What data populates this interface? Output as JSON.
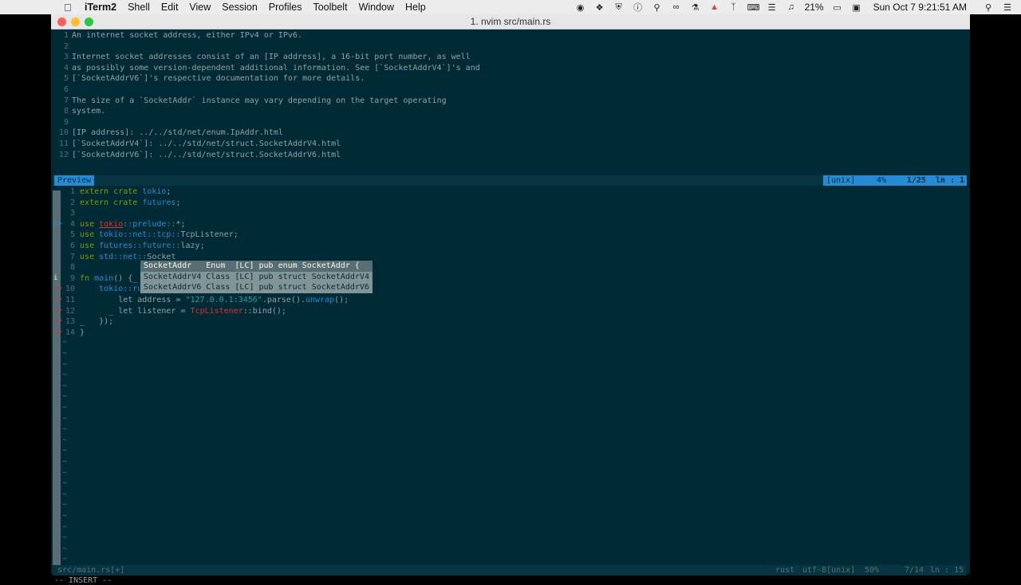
{
  "menubar": {
    "app": "iTerm2",
    "items": [
      "Shell",
      "Edit",
      "View",
      "Session",
      "Profiles",
      "Toolbelt",
      "Window",
      "Help"
    ],
    "battery": "21%",
    "datetime": "Sun Oct 7  9:21:51 AM"
  },
  "window": {
    "title": "1. nvim src/main.rs"
  },
  "preview": {
    "lines": [
      {
        "n": "1",
        "t": "An internet socket address, either IPv4 or IPv6."
      },
      {
        "n": "2",
        "t": ""
      },
      {
        "n": "3",
        "t": "Internet socket addresses consist of an [IP address], a 16-bit port number, as well"
      },
      {
        "n": "4",
        "t": "as possibly some version-dependent additional information. See [`SocketAddrV4`]'s and"
      },
      {
        "n": "5",
        "t": "[`SocketAddrV6`]'s respective documentation for more details."
      },
      {
        "n": "6",
        "t": ""
      },
      {
        "n": "7",
        "t": "The size of a `SocketAddr` instance may vary depending on the target operating"
      },
      {
        "n": "8",
        "t": "system."
      },
      {
        "n": "9",
        "t": ""
      },
      {
        "n": "10",
        "t": "[IP address]: ../../std/net/enum.IpAddr.html"
      },
      {
        "n": "11",
        "t": "[`SocketAddrV4`]: ../../std/net/struct.SocketAddrV4.html"
      },
      {
        "n": "12",
        "t": "[`SocketAddrV6`]: ../../std/net/struct.SocketAddrV6.html"
      }
    ],
    "status": {
      "label": "Preview",
      "format": "[unix]",
      "percent": "4%",
      "pos": "1/25",
      "ln": "ln :  1"
    }
  },
  "code": {
    "l1": {
      "n": "1",
      "a": "extern crate ",
      "b": "tokio",
      "c": ";"
    },
    "l2": {
      "n": "2",
      "a": "extern crate ",
      "b": "futures",
      "c": ";"
    },
    "l3": {
      "n": "3"
    },
    "l4": {
      "n": "4",
      "a": "use ",
      "b": "tokio",
      "c": "::prelude::",
      "d": "*;"
    },
    "l5": {
      "n": "5",
      "a": "use ",
      "b": "tokio::net::tcp::",
      "c": "TcpListener;"
    },
    "l6": {
      "n": "6",
      "a": "use ",
      "b": "futures::future::",
      "c": "lazy;"
    },
    "l7": {
      "n": "7",
      "a": "use ",
      "b": "std::net::",
      "c": "Socket"
    },
    "l8": {
      "n": "8"
    },
    "l9": {
      "n": "9",
      "a": "fn ",
      "b": "main",
      "c": "() {_"
    },
    "l10": {
      "n": "10",
      "a": "    tokio::ru"
    },
    "l11": {
      "n": "11",
      "a": "        let address = ",
      "b": "\"127.0.0.1:3456\"",
      "c": ".parse().",
      "d": "unwrap",
      "e": "();"
    },
    "l12": {
      "n": "12",
      "a": "      _ let listener = ",
      "b": "TcpListener",
      "c": "::bind();"
    },
    "l13": {
      "n": "13",
      "a": "_   });"
    },
    "l14": {
      "n": "14",
      "a": "}"
    }
  },
  "signs": {
    "info": "i",
    "warn": ">>"
  },
  "completion": [
    "SocketAddr   Enum  [LC] pub enum SocketAddr {",
    "SocketAddrV4 Class [LC] pub struct SocketAddrV4",
    "SocketAddrV6 Class [LC] pub struct SocketAddrV6"
  ],
  "tilde": "~",
  "statusline": {
    "file": "src/main.rs[+]",
    "filetype": "rust",
    "encoding": "utf-8[unix]",
    "percent": "50%",
    "pos": "7/14",
    "ln": "ln : 15"
  },
  "mode": "-- INSERT --"
}
